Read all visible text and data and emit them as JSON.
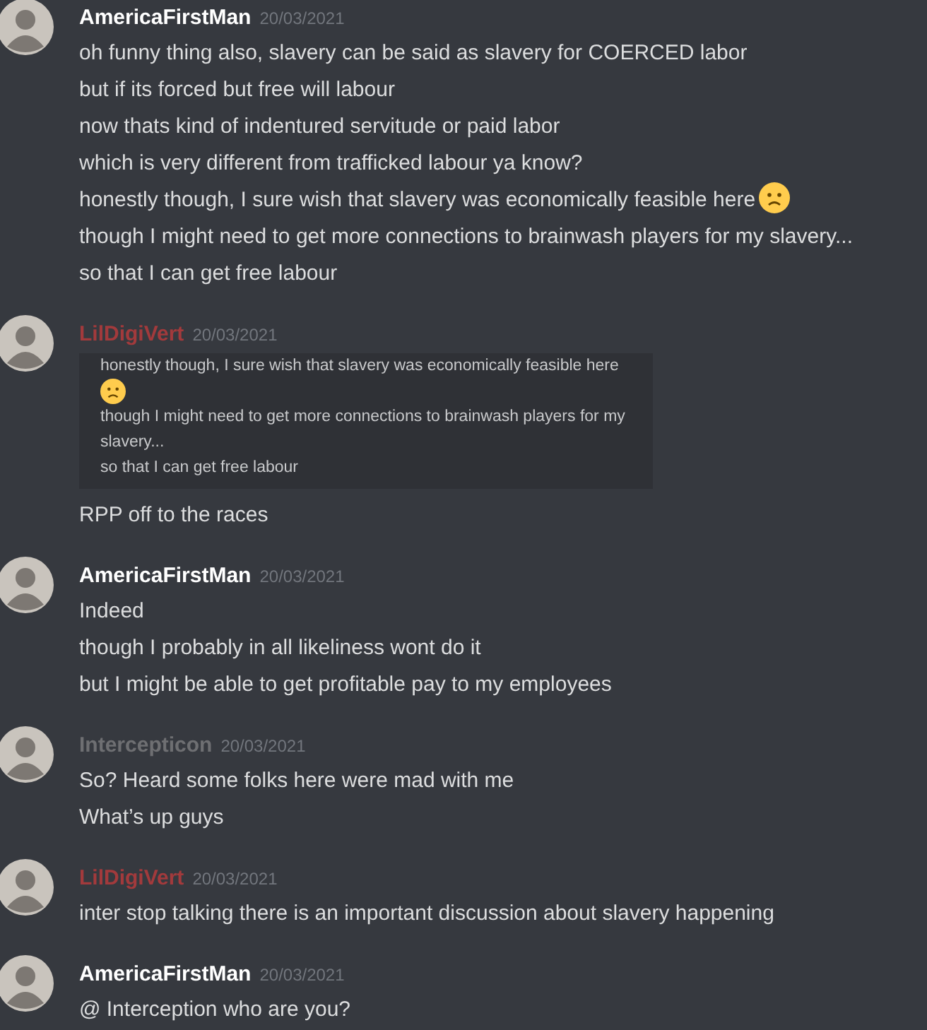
{
  "messages": [
    {
      "author": "AmericaFirstMan",
      "color": "#ffffff",
      "date": "20/03/2021",
      "lines": [
        {
          "kind": "text",
          "text": "oh funny thing also, slavery can be said as slavery for COERCED labor"
        },
        {
          "kind": "text",
          "text": "but if its forced but free will labour"
        },
        {
          "kind": "text",
          "text": "now thats kind of indentured servitude or paid labor"
        },
        {
          "kind": "text",
          "text": "which is very different from trafficked labour ya know?"
        },
        {
          "kind": "text_with_emoji",
          "text": "honestly though, I sure wish that slavery was economically feasible here"
        },
        {
          "kind": "text",
          "text": "though I might need to get more connections to brainwash players for my slavery..."
        },
        {
          "kind": "text",
          "text": "so that I can get free labour"
        }
      ]
    },
    {
      "author": "LilDigiVert",
      "color": "#a23a3c",
      "date": "20/03/2021",
      "lines": [
        {
          "kind": "screenshot",
          "lines": [
            {
              "kind": "text_with_emoji",
              "text": "honestly though, I sure wish that slavery was economically feasible here"
            },
            {
              "kind": "text",
              "text": "though I might need to get more connections to brainwash players for my slavery..."
            },
            {
              "kind": "text",
              "text": "so that I can get free labour"
            }
          ]
        },
        {
          "kind": "text",
          "text": "RPP off to the races"
        }
      ]
    },
    {
      "author": "AmericaFirstMan",
      "color": "#ffffff",
      "date": "20/03/2021",
      "lines": [
        {
          "kind": "text",
          "text": "Indeed"
        },
        {
          "kind": "text",
          "text": "though I probably in all likeliness wont do it"
        },
        {
          "kind": "text",
          "text": "but I might be able to get profitable pay to my employees"
        }
      ]
    },
    {
      "author": "Intercepticon",
      "color": "#6e6f72",
      "date": "20/03/2021",
      "lines": [
        {
          "kind": "text",
          "text": "So? Heard some folks here were mad with me"
        },
        {
          "kind": "text",
          "text": "What’s up guys"
        }
      ]
    },
    {
      "author": "LilDigiVert",
      "color": "#a23a3c",
      "date": "20/03/2021",
      "lines": [
        {
          "kind": "text",
          "text": "inter stop talking there is an important discussion about slavery happening"
        }
      ]
    },
    {
      "author": "AmericaFirstMan",
      "color": "#ffffff",
      "date": "20/03/2021",
      "lines": [
        {
          "kind": "text",
          "text": "@ Interception who are you?"
        }
      ]
    }
  ]
}
